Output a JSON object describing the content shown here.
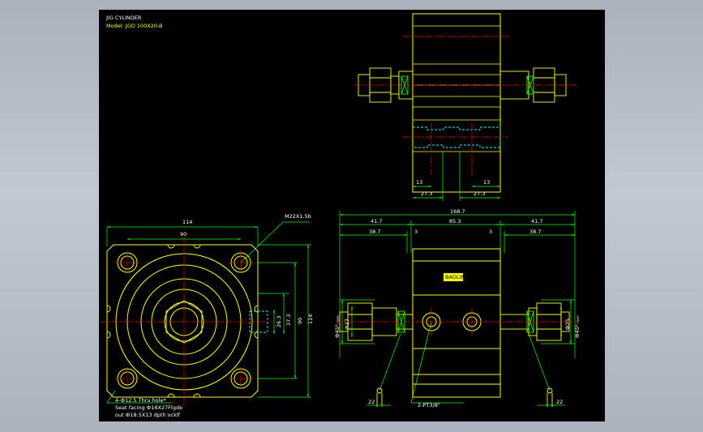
{
  "title_block": {
    "title": "JIG CYLINDER",
    "model": "Model: JGD 100X20-B"
  },
  "colors": {
    "outline": "#ffff00",
    "dimension": "#00ff00",
    "centerline": "#ff0000",
    "hidden": "#00ffff",
    "text": "#ffffff"
  },
  "top_view": {
    "dims": {
      "a": "13",
      "b": "27.3",
      "c": "13",
      "d": "27.3"
    }
  },
  "front_view": {
    "dims": {
      "width": "114",
      "bolt_span": "90",
      "height": "114",
      "bolt_span_v": "90",
      "port_offset": "37.3",
      "port_sub": "26.3"
    },
    "thread_label": "M22X1.5b",
    "notes": {
      "line1": "4-Ф12.5 Thru hole*",
      "line2": "Seat facing Ф16X27Flgde",
      "line3": "out Ф18.5X13 dpth ocklf"
    }
  },
  "side_view": {
    "dims": {
      "overall": "168.7",
      "left": "41.7",
      "middle": "85.3",
      "right": "41.7",
      "inner_left": "38.7",
      "gap_left": "3",
      "gap_right": "3",
      "inner_right": "38.7"
    },
    "vertical_dims": {
      "left_a": "Ф45⁰₋₀₀₅",
      "left_b": "Ф27",
      "right_a": "Ф45⁰₋₀₀₅",
      "right_b": "Ф25"
    },
    "port_label": "2-PT3/8\"",
    "foot_left": "22",
    "foot_right": "22",
    "nameplate": "BAOLIN"
  }
}
